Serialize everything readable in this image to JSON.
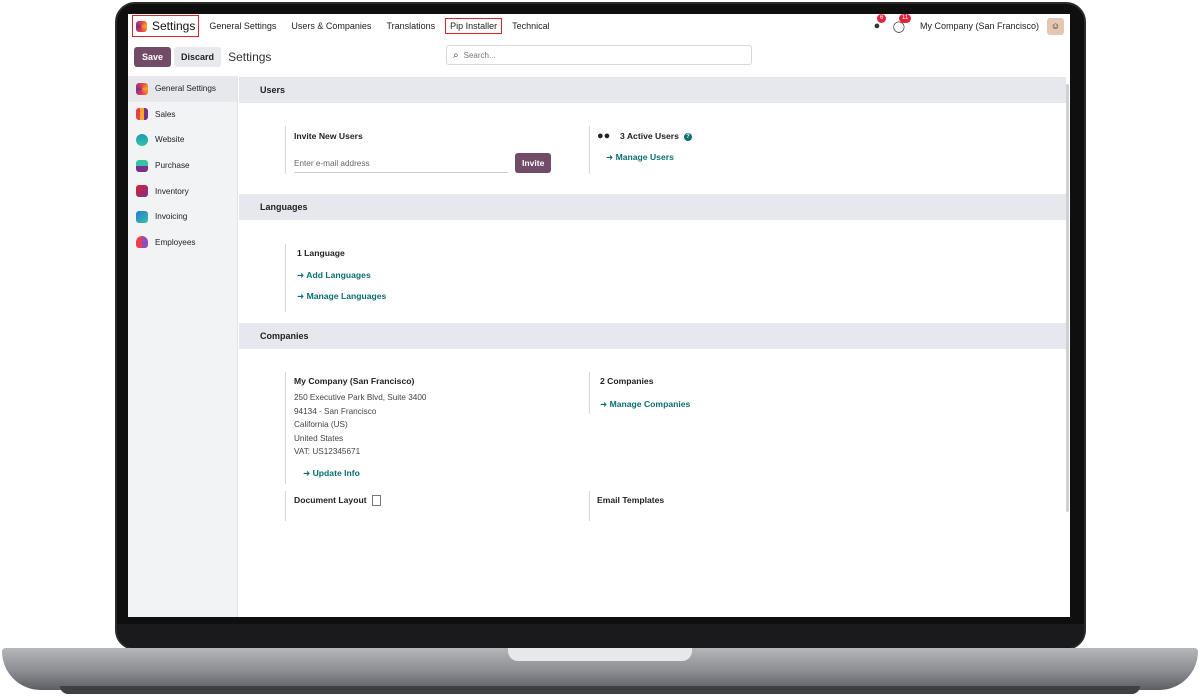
{
  "app": {
    "title": "Settings"
  },
  "topnav": {
    "items": [
      "General Settings",
      "Users & Companies",
      "Translations",
      "Pip Installer",
      "Technical"
    ],
    "chat_badge": "6",
    "activity_badge": "11",
    "company": "My Company (San Francisco)"
  },
  "control": {
    "save": "Save",
    "discard": "Discard",
    "title": "Settings",
    "search_placeholder": "Search..."
  },
  "sidebar": {
    "items": [
      {
        "label": "General Settings",
        "color": "#e8404c"
      },
      {
        "label": "Sales",
        "color": "#f6a623"
      },
      {
        "label": "Website",
        "color": "#1c9bb8"
      },
      {
        "label": "Purchase",
        "color": "#7a2f8f"
      },
      {
        "label": "Inventory",
        "color": "#d9232e"
      },
      {
        "label": "Invoicing",
        "color": "#2a7ad1"
      },
      {
        "label": "Employees",
        "color": "#8d4fbf"
      }
    ]
  },
  "users": {
    "heading": "Users",
    "invite_label": "Invite New Users",
    "email_placeholder": "Enter e-mail address",
    "invite_button": "Invite",
    "active_users": "3 Active Users",
    "manage_users": "Manage Users"
  },
  "languages": {
    "heading": "Languages",
    "count": "1 Language",
    "add": "Add Languages",
    "manage": "Manage Languages"
  },
  "companies": {
    "heading": "Companies",
    "name": "My Company (San Francisco)",
    "address1": "250 Executive Park Blvd, Suite 3400",
    "address2": "94134 - San Francisco",
    "address3": "California (US)",
    "address4": "United States",
    "vat": "VAT:  US12345671",
    "update": "Update Info",
    "count": "2 Companies",
    "manage": "Manage Companies",
    "document_layout": "Document Layout",
    "email_templates": "Email Templates"
  },
  "colors": {
    "primary": "#714b67",
    "link": "#0a6e73",
    "highlight": "#d9232e"
  }
}
